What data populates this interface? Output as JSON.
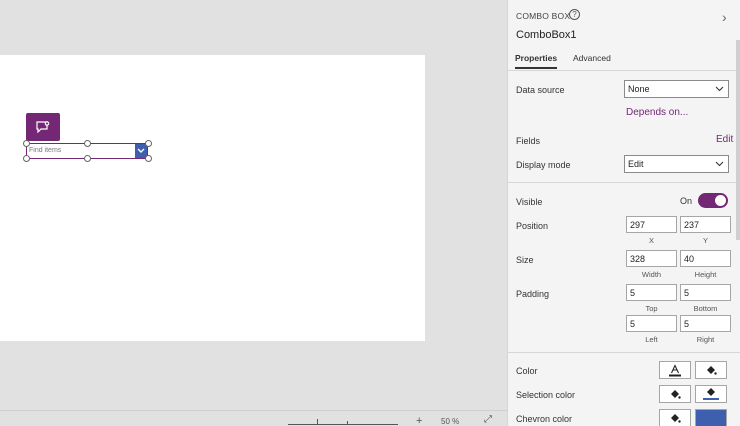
{
  "canvas": {
    "combo_placeholder": "Find items",
    "zoom_value": "50 %"
  },
  "pane": {
    "type_label": "COMBO BOX",
    "help_icon": "?",
    "expand_icon": "›",
    "control_name": "ComboBox1",
    "tabs": [
      {
        "label": "Properties"
      },
      {
        "label": "Advanced"
      }
    ],
    "data_source": {
      "label": "Data source",
      "value": "None",
      "link": "Depends on..."
    },
    "fields": {
      "label": "Fields",
      "action": "Edit"
    },
    "display_mode": {
      "label": "Display mode",
      "value": "Edit"
    },
    "visible": {
      "label": "Visible",
      "state": "On"
    },
    "position": {
      "label": "Position",
      "x": "297",
      "y": "237",
      "x_label": "X",
      "y_label": "Y"
    },
    "size": {
      "label": "Size",
      "width": "328",
      "height": "40",
      "width_label": "Width",
      "height_label": "Height"
    },
    "padding": {
      "label": "Padding",
      "top": "5",
      "bottom": "5",
      "left": "5",
      "right": "5",
      "top_label": "Top",
      "bottom_label": "Bottom",
      "left_label": "Left",
      "right_label": "Right"
    },
    "color": {
      "label": "Color"
    },
    "selection_color": {
      "label": "Selection color"
    },
    "chevron_color": {
      "label": "Chevron color",
      "swatch": "#3e5fad"
    }
  },
  "colors": {
    "accent": "#742774",
    "chevron": "#3e5fad"
  }
}
